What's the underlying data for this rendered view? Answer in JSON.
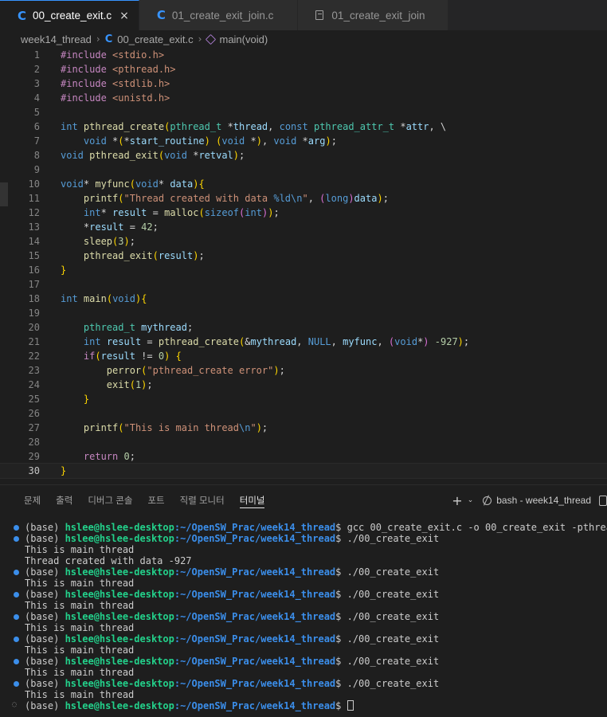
{
  "tabs": [
    {
      "label": "00_create_exit.c",
      "icon": "c-file-icon",
      "active": true,
      "close": "×"
    },
    {
      "label": "01_create_exit_join.c",
      "icon": "c-file-icon",
      "active": false
    },
    {
      "label": "01_create_exit_join",
      "icon": "file-icon",
      "active": false
    }
  ],
  "breadcrumb": {
    "folder": "week14_thread",
    "file": "00_create_exit.c",
    "symbol": "main(void)"
  },
  "editor": {
    "line_numbers": [
      "1",
      "2",
      "3",
      "4",
      "5",
      "6",
      "7",
      "8",
      "9",
      "10",
      "11",
      "12",
      "13",
      "14",
      "15",
      "16",
      "17",
      "18",
      "19",
      "20",
      "21",
      "22",
      "23",
      "24",
      "25",
      "26",
      "27",
      "28",
      "29",
      "30"
    ],
    "current_line": "30",
    "code": [
      "#include <stdio.h>",
      "#include <pthread.h>",
      "#include <stdlib.h>",
      "#include <unistd.h>",
      "",
      "int pthread_create(pthread_t *thread, const pthread_attr_t *attr, \\",
      "    void *(*start_routine) (void *), void *arg);",
      "void pthread_exit(void *retval);",
      "",
      "void* myfunc(void* data){",
      "    printf(\"Thread created with data %ld\\n\", (long)data);",
      "    int* result = malloc(sizeof(int));",
      "    *result = 42;",
      "    sleep(3);",
      "    pthread_exit(result);",
      "}",
      "",
      "int main(void){",
      "",
      "    pthread_t mythread;",
      "    int result = pthread_create(&mythread, NULL, myfunc, (void*) -927);",
      "    if(result != 0) {",
      "        perror(\"pthread_create error\");",
      "        exit(1);",
      "    }",
      "",
      "    printf(\"This is main thread\\n\");",
      "",
      "    return 0;",
      "}"
    ]
  },
  "panel": {
    "tabs": [
      "문제",
      "출력",
      "디버그 콘솔",
      "포트",
      "직렬 모니터",
      "터미널"
    ],
    "active_tab": "터미널",
    "terminal_name": "bash - week14_thread",
    "terminal_lines": [
      {
        "type": "prompt",
        "env": "(base) ",
        "user": "hslee@hslee-desktop",
        "path": ":~/OpenSW_Prac/week14_thread",
        "cmd": "$ gcc 00_create_exit.c -o 00_create_exit -pthread"
      },
      {
        "type": "prompt",
        "env": "(base) ",
        "user": "hslee@hslee-desktop",
        "path": ":~/OpenSW_Prac/week14_thread",
        "cmd": "$ ./00_create_exit"
      },
      {
        "type": "output",
        "text": "This is main thread"
      },
      {
        "type": "output",
        "text": "Thread created with data -927"
      },
      {
        "type": "prompt",
        "env": "(base) ",
        "user": "hslee@hslee-desktop",
        "path": ":~/OpenSW_Prac/week14_thread",
        "cmd": "$ ./00_create_exit"
      },
      {
        "type": "output",
        "text": "This is main thread"
      },
      {
        "type": "prompt",
        "env": "(base) ",
        "user": "hslee@hslee-desktop",
        "path": ":~/OpenSW_Prac/week14_thread",
        "cmd": "$ ./00_create_exit"
      },
      {
        "type": "output",
        "text": "This is main thread"
      },
      {
        "type": "prompt",
        "env": "(base) ",
        "user": "hslee@hslee-desktop",
        "path": ":~/OpenSW_Prac/week14_thread",
        "cmd": "$ ./00_create_exit"
      },
      {
        "type": "output",
        "text": "This is main thread"
      },
      {
        "type": "prompt",
        "env": "(base) ",
        "user": "hslee@hslee-desktop",
        "path": ":~/OpenSW_Prac/week14_thread",
        "cmd": "$ ./00_create_exit"
      },
      {
        "type": "output",
        "text": "This is main thread"
      },
      {
        "type": "prompt",
        "env": "(base) ",
        "user": "hslee@hslee-desktop",
        "path": ":~/OpenSW_Prac/week14_thread",
        "cmd": "$ ./00_create_exit"
      },
      {
        "type": "output",
        "text": "This is main thread"
      },
      {
        "type": "prompt",
        "env": "(base) ",
        "user": "hslee@hslee-desktop",
        "path": ":~/OpenSW_Prac/week14_thread",
        "cmd": "$ ./00_create_exit"
      },
      {
        "type": "output",
        "text": "This is main thread"
      },
      {
        "type": "prompt-last",
        "env": "(base) ",
        "user": "hslee@hslee-desktop",
        "path": ":~/OpenSW_Prac/week14_thread",
        "cmd": "$ "
      }
    ]
  },
  "colors": {
    "accent": "#3794ff",
    "prompt_user": "#23d18b",
    "prompt_path": "#3b8eea",
    "background": "#1e1e1e"
  }
}
